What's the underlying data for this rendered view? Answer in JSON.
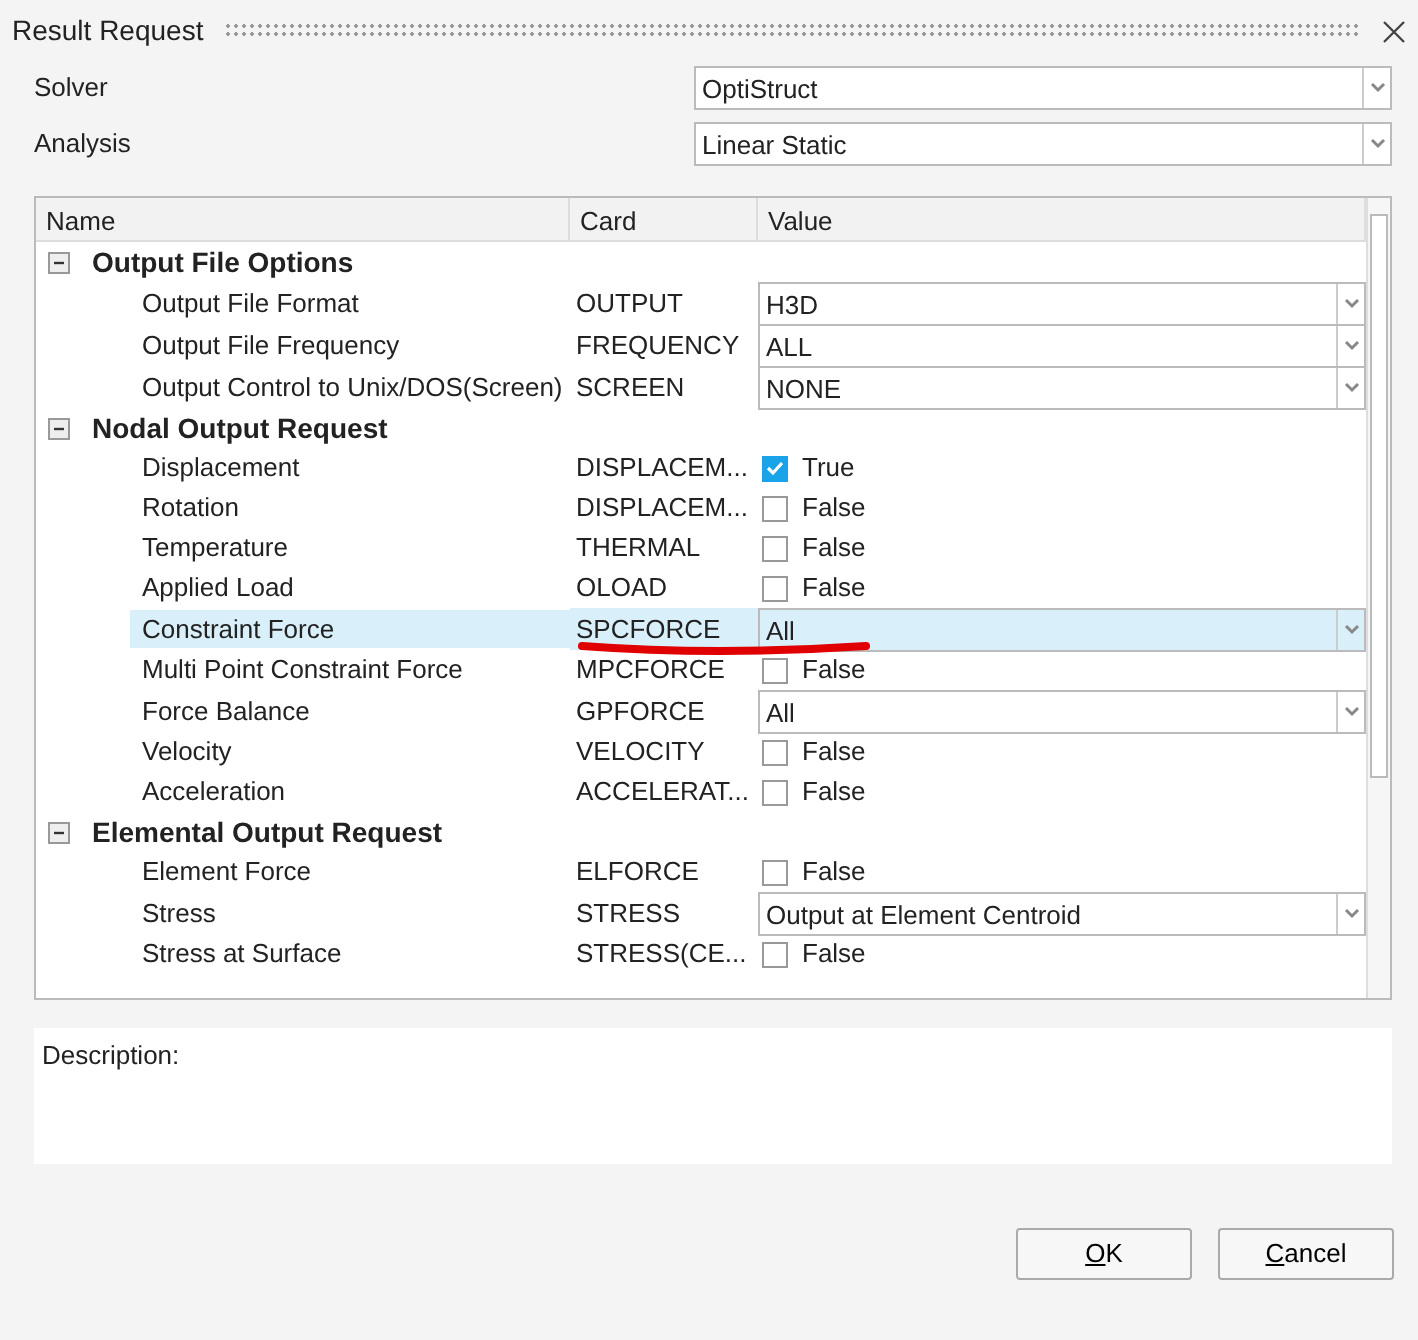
{
  "window": {
    "title": "Result Request"
  },
  "fields": [
    {
      "label": "Solver",
      "value": "OptiStruct"
    },
    {
      "label": "Analysis",
      "value": "Linear Static"
    }
  ],
  "table": {
    "columns": [
      "Name",
      "Card",
      "Value"
    ],
    "groups": [
      {
        "name": "Output File Options",
        "expanded": true,
        "children": [
          {
            "name": "Output File Format",
            "card": "OUTPUT",
            "kind": "select",
            "value": "H3D",
            "selected": false,
            "marked": false
          },
          {
            "name": "Output File Frequency",
            "card": "FREQUENCY",
            "kind": "select",
            "value": "ALL",
            "selected": false,
            "marked": false
          },
          {
            "name": "Output Control to Unix/DOS(Screen)",
            "card": "SCREEN",
            "kind": "select",
            "value": "NONE",
            "selected": false,
            "marked": false
          }
        ]
      },
      {
        "name": "Nodal Output Request",
        "expanded": true,
        "children": [
          {
            "name": "Displacement",
            "card": "DISPLACEM...",
            "kind": "checkbox",
            "checked": true,
            "value": "True",
            "selected": false,
            "marked": false
          },
          {
            "name": "Rotation",
            "card": "DISPLACEM...",
            "kind": "checkbox",
            "checked": false,
            "value": "False",
            "selected": false,
            "marked": false
          },
          {
            "name": "Temperature",
            "card": "THERMAL",
            "kind": "checkbox",
            "checked": false,
            "value": "False",
            "selected": false,
            "marked": false
          },
          {
            "name": "Applied Load",
            "card": "OLOAD",
            "kind": "checkbox",
            "checked": false,
            "value": "False",
            "selected": false,
            "marked": false
          },
          {
            "name": "Constraint Force",
            "card": "SPCFORCE",
            "kind": "select",
            "value": "All",
            "selected": true,
            "marked": true
          },
          {
            "name": "Multi Point Constraint Force",
            "card": "MPCFORCE",
            "kind": "checkbox",
            "checked": false,
            "value": "False",
            "selected": false,
            "marked": false
          },
          {
            "name": "Force Balance",
            "card": "GPFORCE",
            "kind": "select",
            "value": "All",
            "selected": false,
            "marked": false
          },
          {
            "name": "Velocity",
            "card": "VELOCITY",
            "kind": "checkbox",
            "checked": false,
            "value": "False",
            "selected": false,
            "marked": false
          },
          {
            "name": "Acceleration",
            "card": "ACCELERAT...",
            "kind": "checkbox",
            "checked": false,
            "value": "False",
            "selected": false,
            "marked": false
          }
        ]
      },
      {
        "name": "Elemental Output Request",
        "expanded": true,
        "children": [
          {
            "name": "Element Force",
            "card": "ELFORCE",
            "kind": "checkbox",
            "checked": false,
            "value": "False",
            "selected": false,
            "marked": false
          },
          {
            "name": "Stress",
            "card": "STRESS",
            "kind": "select",
            "value": "Output at Element Centroid",
            "selected": false,
            "marked": false
          },
          {
            "name": "Stress at Surface",
            "card": "STRESS(CE...",
            "kind": "checkbox",
            "checked": false,
            "value": "False",
            "selected": false,
            "marked": false
          }
        ]
      }
    ]
  },
  "description": {
    "label": "Description:"
  },
  "buttons": [
    {
      "label": "OK",
      "mnemonic": true
    },
    {
      "label": "Cancel",
      "mnemonic": true
    }
  ]
}
